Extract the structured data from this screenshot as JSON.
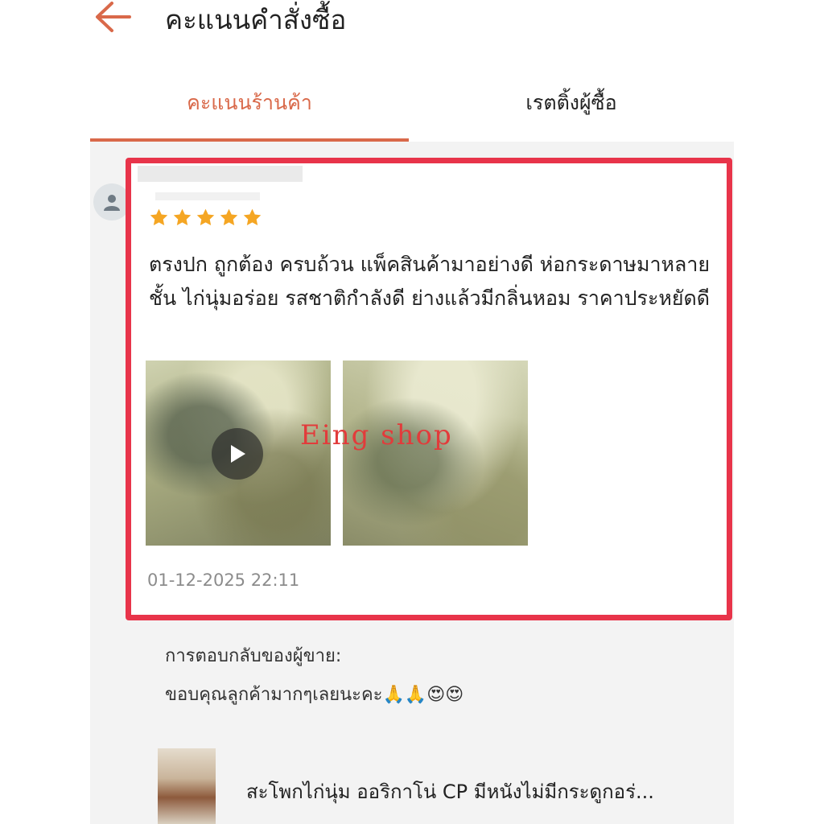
{
  "header": {
    "title": "คะแนนคำสั่งซื้อ",
    "back_icon": "arrow-left-icon"
  },
  "tabs": [
    {
      "label": "คะแนนร้านค้า",
      "active": true
    },
    {
      "label": "เรตติ้งผู้ซื้อ",
      "active": false
    }
  ],
  "review": {
    "rating": 5,
    "text": "ตรงปก ถูกต้อง ครบถ้วน แพ็คสินค้ามาอย่างดี ห่อกระดาษมาหลายชั้น ไก่นุ่มอร่อย รสชาติกำลังดี ย่างแล้วมีกลิ่นหอม ราคาประหยัดดี",
    "watermark": "Eing shop",
    "date": "01-12-2025 22:11"
  },
  "seller_reply": {
    "label": "การตอบกลับของผู้ขาย:",
    "text": "ขอบคุณลูกค้ามากๆเลยนะคะ🙏🙏😍😍"
  },
  "product": {
    "title": "สะโพกไก่นุ่ม ออริกาโน่ CP มีหนังไม่มีกระดูกอร่..."
  },
  "colors": {
    "accent": "#d9694a",
    "highlight_border": "#e8344a",
    "star": "#f5a623"
  }
}
